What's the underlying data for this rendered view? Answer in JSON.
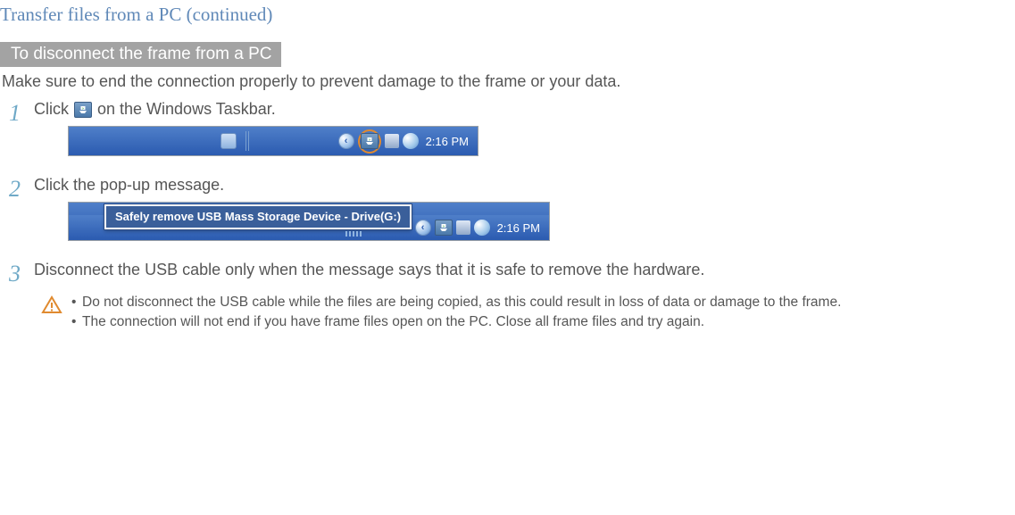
{
  "pageTitle": "Transfer files from a PC  (continued)",
  "sectionHeading": "To disconnect the frame from a PC",
  "intro": "Make sure to end the connection properly to prevent damage to the frame or your data.",
  "steps": {
    "s1": {
      "num": "1",
      "pre": "Click",
      "post": "on the Windows Taskbar."
    },
    "s2": {
      "num": "2",
      "text": "Click the pop-up message."
    },
    "s3": {
      "num": "3",
      "text": "Disconnect the USB cable only when the message says that it is safe to remove the hardware."
    }
  },
  "taskbar": {
    "time": "2:16 PM",
    "arrow_glyph": "‹",
    "tooltip": "Safely remove USB Mass Storage Device - Drive(G:)"
  },
  "caution": {
    "b1": "Do not disconnect the USB cable while the files are being copied, as this could result in loss of data or damage to the frame.",
    "b2": "The connection will not end if you have frame files open on the PC. Close all frame files and try again."
  }
}
